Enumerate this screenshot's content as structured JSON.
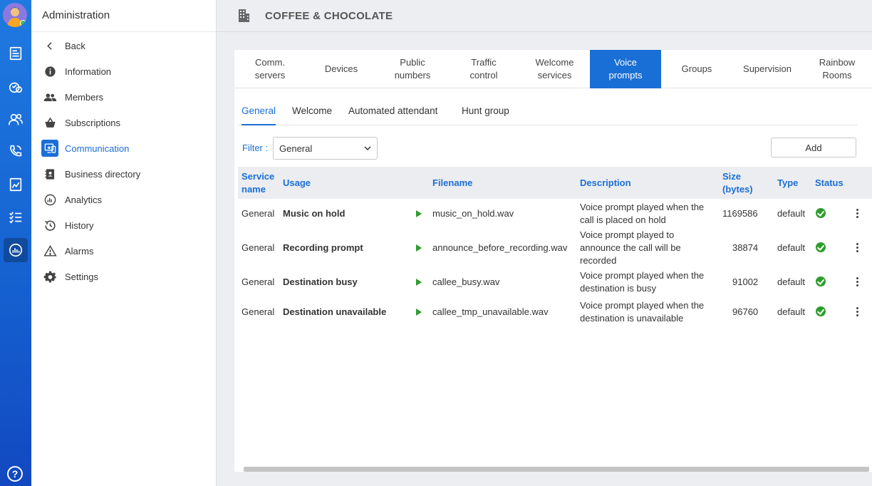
{
  "app": {
    "title": "Administration",
    "organization": "COFFEE & CHOCOLATE",
    "help_label": "?"
  },
  "sidenav": {
    "items": [
      {
        "label": "Back",
        "icon": "chevron-left-icon"
      },
      {
        "label": "Information",
        "icon": "info-icon"
      },
      {
        "label": "Members",
        "icon": "members-icon"
      },
      {
        "label": "Subscriptions",
        "icon": "basket-icon"
      },
      {
        "label": "Communication",
        "icon": "communication-icon",
        "active": true
      },
      {
        "label": "Business directory",
        "icon": "directory-icon"
      },
      {
        "label": "Analytics",
        "icon": "analytics-icon"
      },
      {
        "label": "History",
        "icon": "history-icon"
      },
      {
        "label": "Alarms",
        "icon": "alarm-icon"
      },
      {
        "label": "Settings",
        "icon": "gear-icon"
      }
    ]
  },
  "tabs": [
    {
      "label": "Comm. servers"
    },
    {
      "label": "Devices"
    },
    {
      "label": "Public numbers"
    },
    {
      "label": "Traffic control"
    },
    {
      "label": "Welcome services"
    },
    {
      "label": "Voice prompts",
      "active": true
    },
    {
      "label": "Groups"
    },
    {
      "label": "Supervision"
    },
    {
      "label": "Rainbow Rooms"
    }
  ],
  "subtabs": [
    {
      "label": "General",
      "active": true
    },
    {
      "label": "Welcome"
    },
    {
      "label": "Automated attendant"
    },
    {
      "label": "Hunt group"
    }
  ],
  "filter": {
    "label": "Filter :",
    "value": "General"
  },
  "add_label": "Add",
  "table": {
    "headers": {
      "service_name": "Service name",
      "usage": "Usage",
      "filename": "Filename",
      "description": "Description",
      "size": "Size (bytes)",
      "type": "Type",
      "status": "Status"
    },
    "rows": [
      {
        "service": "General",
        "usage": "Music on hold",
        "filename": "music_on_hold.wav",
        "description": "Voice prompt played when the call is placed on hold",
        "size": "1169586",
        "type": "default"
      },
      {
        "service": "General",
        "usage": "Recording prompt",
        "filename": "announce_before_recording.wav",
        "description": "Voice prompt played to announce the call will be recorded",
        "size": "38874",
        "type": "default"
      },
      {
        "service": "General",
        "usage": "Destination busy",
        "filename": "callee_busy.wav",
        "description": "Voice prompt played when the destination is busy",
        "size": "91002",
        "type": "default"
      },
      {
        "service": "General",
        "usage": "Destination unavailable",
        "filename": "callee_tmp_unavailable.wav",
        "description": "Voice prompt played when the destination is unavailable",
        "size": "96760",
        "type": "default"
      }
    ]
  },
  "colors": {
    "accent": "#1a6fd6",
    "rail": "#1560d0",
    "status_ok": "#2e9d2e"
  }
}
